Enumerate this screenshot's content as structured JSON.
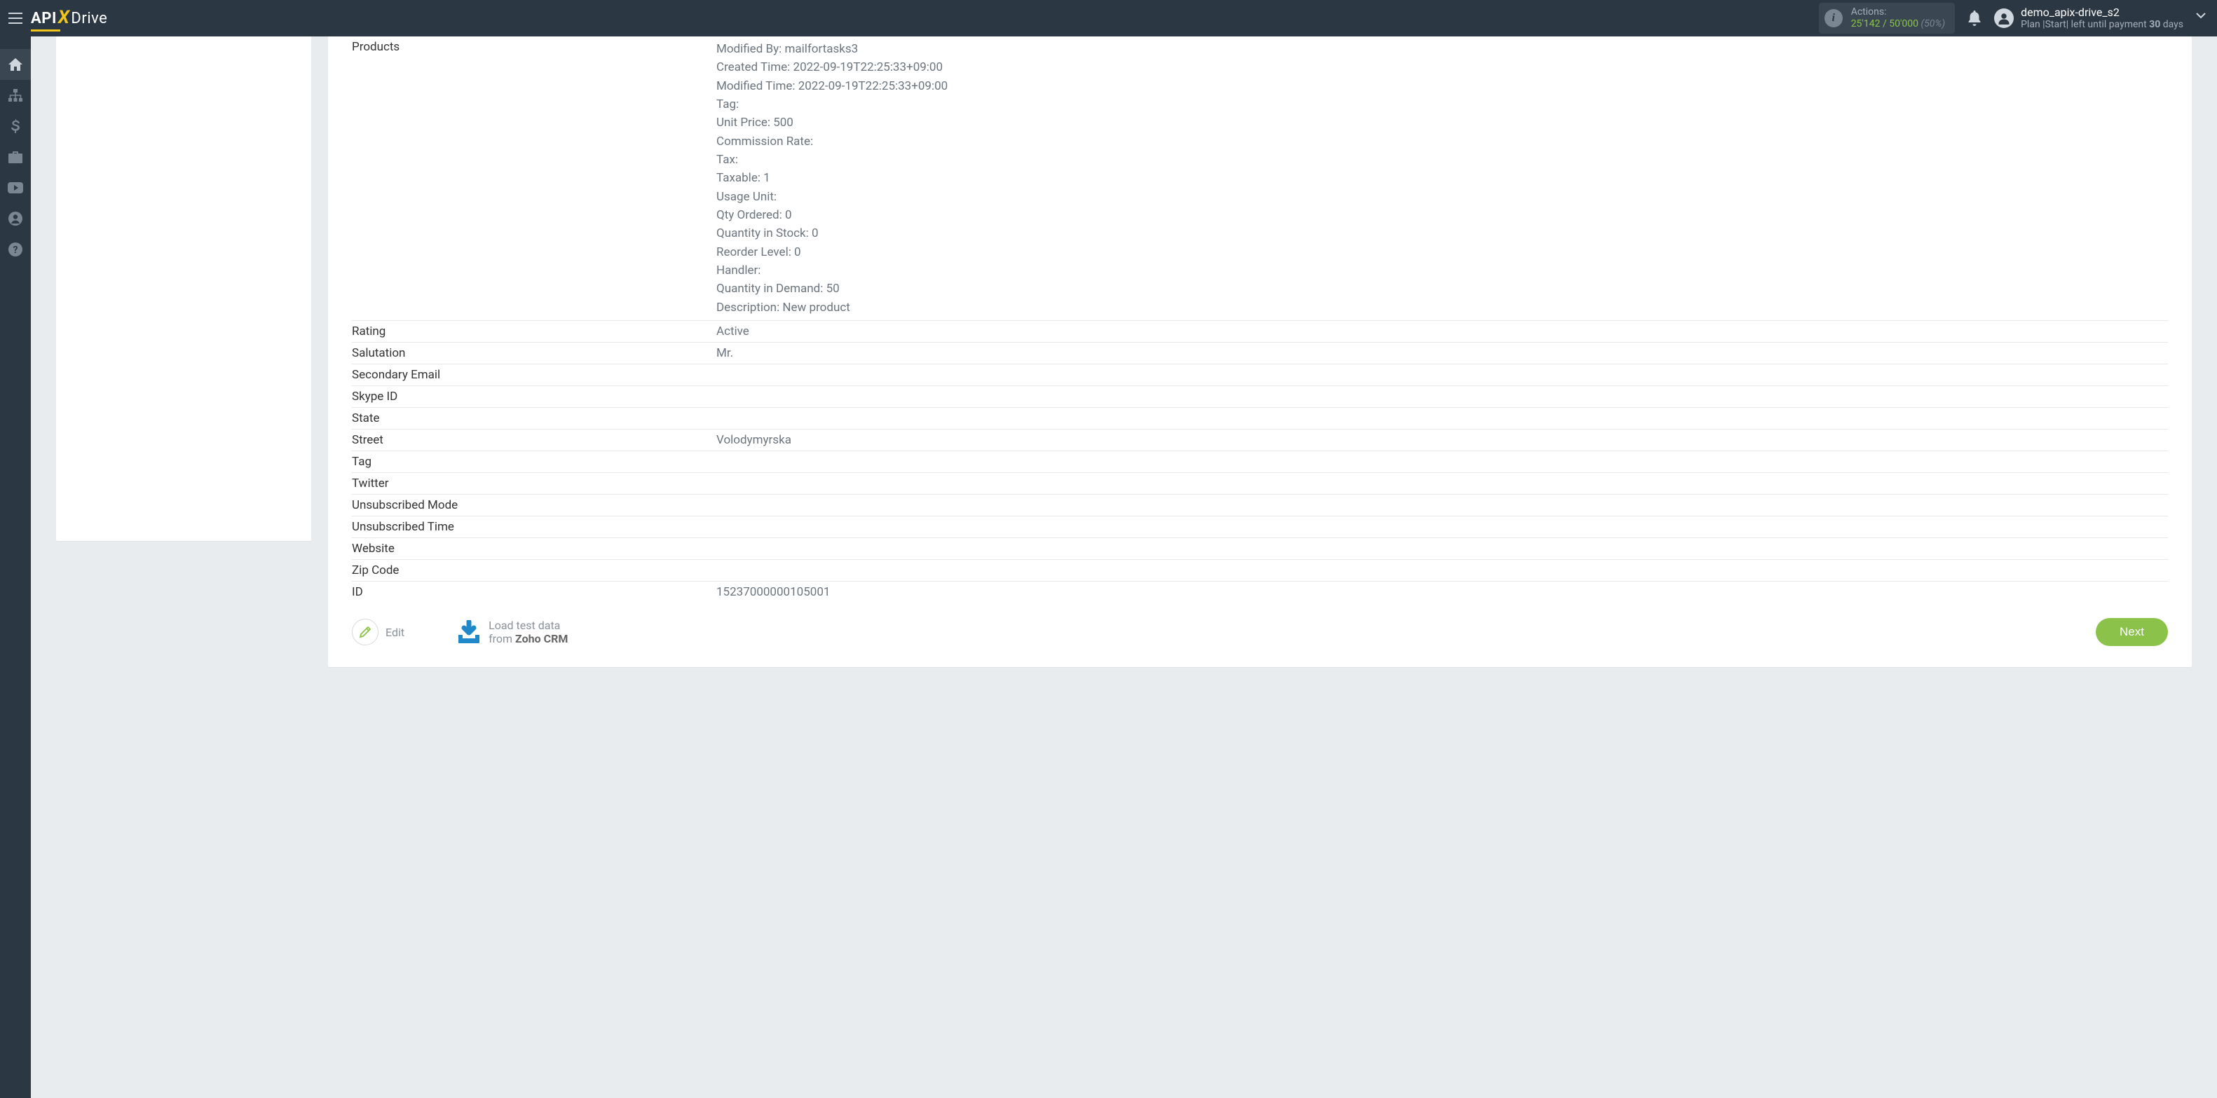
{
  "brand": {
    "left": "API",
    "x": "X",
    "right": "Drive"
  },
  "topbar": {
    "actions_label": "Actions:",
    "actions_current": "25'142",
    "actions_slash": " / ",
    "actions_max": "50'000",
    "actions_pct": "(50%)"
  },
  "user": {
    "name": "demo_apix-drive_s2",
    "plan_prefix": "Plan |Start|  left until payment ",
    "plan_days": "30",
    "plan_suffix": " days"
  },
  "sidebar": {},
  "rows": [
    {
      "key": "Products",
      "val": "Modified By: mailfortasks3\nCreated Time: 2022-09-19T22:25:33+09:00\nModified Time: 2022-09-19T22:25:33+09:00\nTag:\nUnit Price: 500\nCommission Rate:\nTax:\nTaxable: 1\nUsage Unit:\nQty Ordered: 0\nQuantity in Stock: 0\nReorder Level: 0\nHandler:\nQuantity in Demand: 50\nDescription: New product",
      "multiline": true
    },
    {
      "key": "Rating",
      "val": "Active"
    },
    {
      "key": "Salutation",
      "val": "Mr."
    },
    {
      "key": "Secondary Email",
      "val": ""
    },
    {
      "key": "Skype ID",
      "val": ""
    },
    {
      "key": "State",
      "val": ""
    },
    {
      "key": "Street",
      "val": "Volodymyrska"
    },
    {
      "key": "Tag",
      "val": ""
    },
    {
      "key": "Twitter",
      "val": ""
    },
    {
      "key": "Unsubscribed Mode",
      "val": ""
    },
    {
      "key": "Unsubscribed Time",
      "val": ""
    },
    {
      "key": "Website",
      "val": ""
    },
    {
      "key": "Zip Code",
      "val": ""
    },
    {
      "key": "ID",
      "val": "15237000000105001"
    }
  ],
  "buttons": {
    "edit": "Edit",
    "load_line1": "Load test data",
    "load_line2_prefix": "from ",
    "load_line2_bold": "Zoho CRM",
    "next": "Next"
  }
}
